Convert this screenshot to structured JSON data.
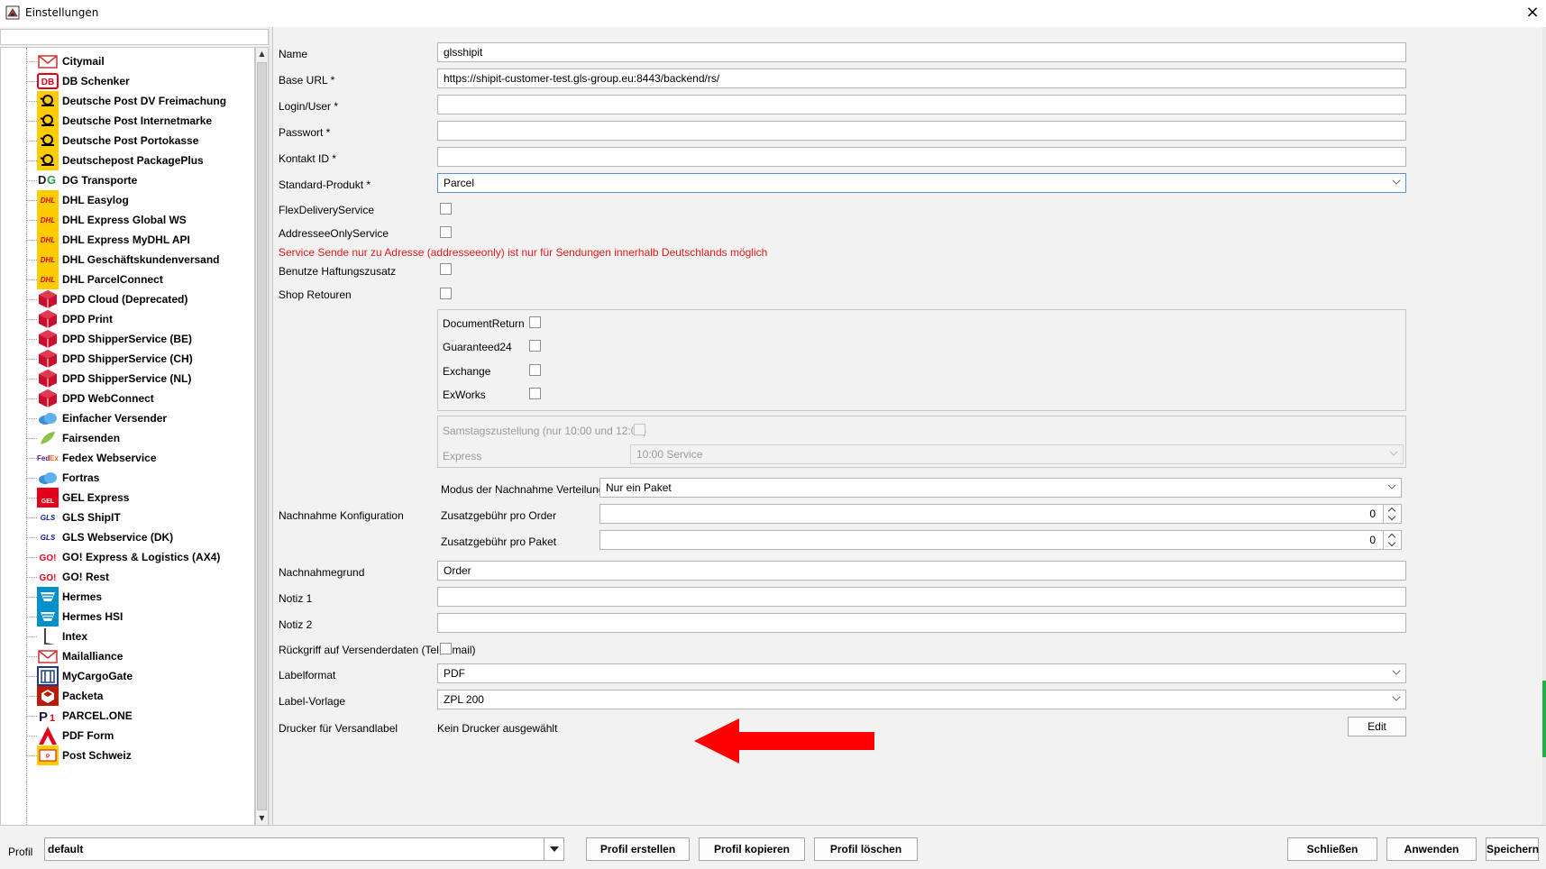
{
  "window": {
    "title": "Einstellungen",
    "close_icon": "×"
  },
  "sidebar": {
    "search_value": "",
    "items": [
      {
        "label": "Citymail",
        "icon": "envelope-icon"
      },
      {
        "label": "DB Schenker",
        "icon": "db-logo-icon"
      },
      {
        "label": "Deutsche Post DV Freimachung",
        "icon": "post-horn-icon"
      },
      {
        "label": "Deutsche Post Internetmarke",
        "icon": "post-horn-icon"
      },
      {
        "label": "Deutsche Post Portokasse",
        "icon": "post-horn-icon"
      },
      {
        "label": "Deutschepost PackagePlus",
        "icon": "post-horn-icon"
      },
      {
        "label": "DG Transporte",
        "icon": "dg-logo-icon"
      },
      {
        "label": "DHL Easylog",
        "icon": "dhl-logo-icon"
      },
      {
        "label": "DHL Express Global WS",
        "icon": "dhl-logo-icon"
      },
      {
        "label": "DHL Express MyDHL API",
        "icon": "dhl-logo-icon"
      },
      {
        "label": "DHL Geschäftskundenversand",
        "icon": "dhl-logo-icon"
      },
      {
        "label": "DHL ParcelConnect",
        "icon": "dhl-logo-icon"
      },
      {
        "label": "DPD Cloud (Deprecated)",
        "icon": "dpd-cube-icon"
      },
      {
        "label": "DPD Print",
        "icon": "dpd-cube-icon"
      },
      {
        "label": "DPD ShipperService (BE)",
        "icon": "dpd-cube-icon"
      },
      {
        "label": "DPD ShipperService (CH)",
        "icon": "dpd-cube-icon"
      },
      {
        "label": "DPD ShipperService (NL)",
        "icon": "dpd-cube-icon"
      },
      {
        "label": "DPD WebConnect",
        "icon": "dpd-cube-icon"
      },
      {
        "label": "Einfacher Versender",
        "icon": "cloud-icon"
      },
      {
        "label": "Fairsenden",
        "icon": "leaf-icon"
      },
      {
        "label": "Fedex Webservice",
        "icon": "fedex-logo-icon"
      },
      {
        "label": "Fortras",
        "icon": "cloud-icon"
      },
      {
        "label": "GEL Express",
        "icon": "gel-logo-icon"
      },
      {
        "label": "GLS ShipIT",
        "icon": "gls-logo-icon"
      },
      {
        "label": "GLS Webservice (DK)",
        "icon": "gls-logo-icon"
      },
      {
        "label": "GO! Express & Logistics (AX4)",
        "icon": "go-logo-icon"
      },
      {
        "label": "GO! Rest",
        "icon": "go-logo-icon"
      },
      {
        "label": "Hermes",
        "icon": "hermes-logo-icon"
      },
      {
        "label": "Hermes HSI",
        "icon": "hermes-logo-icon"
      },
      {
        "label": "Intex",
        "icon": "intex-logo-icon"
      },
      {
        "label": "Mailalliance",
        "icon": "envelope-icon"
      },
      {
        "label": "MyCargoGate",
        "icon": "mycargogate-logo-icon"
      },
      {
        "label": "Packeta",
        "icon": "packeta-logo-icon"
      },
      {
        "label": "PARCEL.ONE",
        "icon": "parcelone-logo-icon"
      },
      {
        "label": "PDF Form",
        "icon": "pdf-icon"
      },
      {
        "label": "Post Schweiz",
        "icon": "swiss-post-icon"
      }
    ]
  },
  "form": {
    "name": {
      "label": "Name",
      "value": "glsshipit"
    },
    "base_url": {
      "label": "Base URL *",
      "value": "https://shipit-customer-test.gls-group.eu:8443/backend/rs/"
    },
    "login": {
      "label": "Login/User *",
      "value": ""
    },
    "passwort": {
      "label": "Passwort *",
      "value": ""
    },
    "kontakt": {
      "label": "Kontakt ID *",
      "value": ""
    },
    "standard_produkt": {
      "label": "Standard-Produkt *",
      "value": "Parcel"
    },
    "flex": {
      "label": "FlexDeliveryService"
    },
    "addressee": {
      "label": "AddresseeOnlyService"
    },
    "warning": "Service Sende nur zu Adresse (addresseeonly) ist nur für Sendungen innerhalb Deutschlands möglich",
    "haftung": {
      "label": "Benutze Haftungszusatz"
    },
    "shop_retouren": {
      "label": "Shop Retouren"
    },
    "services": [
      {
        "label": "DocumentReturn"
      },
      {
        "label": "Guaranteed24"
      },
      {
        "label": "Exchange"
      },
      {
        "label": "ExWorks"
      }
    ],
    "samstag": {
      "label": "Samstagszustellung (nur 10:00 und 12:00)"
    },
    "express": {
      "label": "Express",
      "value": "10:00 Service"
    },
    "nachnahme": {
      "label": "Nachnahme Konfiguration",
      "modus_label": "Modus der Nachnahme Verteilung",
      "modus_value": "Nur ein Paket",
      "order_label": "Zusatzgebühr pro Order",
      "order_value": "0",
      "paket_label": "Zusatzgebühr pro Paket",
      "paket_value": "0"
    },
    "nachnahmegrund": {
      "label": "Nachnahmegrund",
      "value": "Order"
    },
    "notiz1": {
      "label": "Notiz 1",
      "value": ""
    },
    "notiz2": {
      "label": "Notiz 2",
      "value": ""
    },
    "rueckgriff": {
      "label": "Rückgriff auf Versenderdaten (Tel, Email)"
    },
    "labelformat": {
      "label": "Labelformat",
      "value": "PDF"
    },
    "label_vorlage": {
      "label": "Label-Vorlage",
      "value": "ZPL 200"
    },
    "drucker": {
      "label": "Drucker für Versandlabel",
      "value": "Kein Drucker ausgewählt",
      "edit_label": "Edit"
    }
  },
  "footer": {
    "profil_label": "Profil",
    "profil_value": "default",
    "buttons": {
      "erstellen": "Profil erstellen",
      "kopieren": "Profil kopieren",
      "loeschen": "Profil löschen",
      "schliessen": "Schließen",
      "anwenden": "Anwenden",
      "speichern": "Speichern"
    }
  },
  "colors": {
    "warning": "#e01b1b",
    "annotation_arrow": "#ff0000",
    "dhl_yellow": "#ffcc00",
    "dpd_red": "#c8102e",
    "post_yellow": "#ffcc00"
  }
}
